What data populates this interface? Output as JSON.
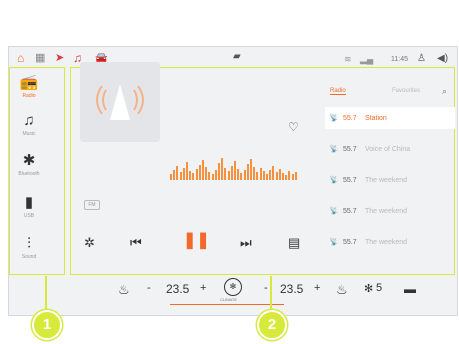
{
  "status_bar": {
    "icons": [
      "home-icon",
      "grid-icon",
      "navigation-icon",
      "music-icon",
      "car-icon",
      "notification-icon",
      "wifi-icon",
      "signal-icon",
      "user-icon",
      "volume-icon"
    ],
    "time": "11:45"
  },
  "sidebar": {
    "items": [
      {
        "label": "Radio",
        "icon": "radio-icon"
      },
      {
        "label": "Music",
        "icon": "music-note-icon"
      },
      {
        "label": "Bluetooth",
        "icon": "bluetooth-icon"
      },
      {
        "label": "USB",
        "icon": "usb-icon"
      },
      {
        "label": "Sound",
        "icon": "sound-settings-icon"
      }
    ]
  },
  "player": {
    "band_label": "FM",
    "format_badge": "FM",
    "tabs": [
      "Radio",
      "Favourites"
    ],
    "stations": [
      {
        "freq": "55.7",
        "name": "Station"
      },
      {
        "freq": "55.7",
        "name": "Voice of China"
      },
      {
        "freq": "55.7",
        "name": "The weekend"
      },
      {
        "freq": "55.7",
        "name": "The weekend"
      },
      {
        "freq": "55.7",
        "name": "The weekend"
      }
    ]
  },
  "climate": {
    "left_temp": "23.5",
    "right_temp": "23.5",
    "fan_level": "5",
    "label": "CLIMATE",
    "minus": "-",
    "plus": "+"
  },
  "callouts": [
    "1",
    "2"
  ],
  "colors": {
    "accent": "#f26a2a",
    "highlight": "#d7ea3b"
  }
}
